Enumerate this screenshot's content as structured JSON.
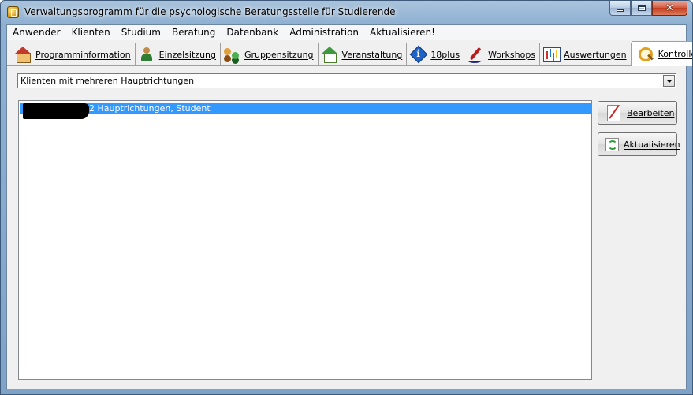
{
  "window": {
    "title": "Verwaltungsprogramm für die psychologische Beratungsstelle für Studierende"
  },
  "menu": [
    {
      "label": "Anwender"
    },
    {
      "label": "Klienten"
    },
    {
      "label": "Studium"
    },
    {
      "label": "Beratung"
    },
    {
      "label": "Datenbank"
    },
    {
      "label": "Administration"
    },
    {
      "label": "Aktualisieren!"
    }
  ],
  "tabs": [
    {
      "label": "Programminformation",
      "icon": "house-icon"
    },
    {
      "label": "Einzelsitzung",
      "icon": "person-icon"
    },
    {
      "label": "Gruppensitzung",
      "icon": "group-icon"
    },
    {
      "label": "Veranstaltung",
      "icon": "event-house-icon"
    },
    {
      "label": "18plus",
      "icon": "info-icon"
    },
    {
      "label": "Workshops",
      "icon": "pen-icon"
    },
    {
      "label": "Auswertungen",
      "icon": "chart-icon"
    },
    {
      "label": "Kontrolle",
      "icon": "magnifier-icon",
      "active": true
    }
  ],
  "filter": {
    "selected": "Klienten mit mehreren Hauptrichtungen"
  },
  "list": {
    "rows": [
      {
        "text": "2 Hauptrichtungen, Student",
        "selected": true,
        "redacted_prefix": true
      }
    ]
  },
  "buttons": {
    "edit": "Bearbeiten",
    "refresh": "Aktualisieren"
  },
  "colors": {
    "selection": "#3399ff",
    "panel": "#f0f0f0"
  }
}
